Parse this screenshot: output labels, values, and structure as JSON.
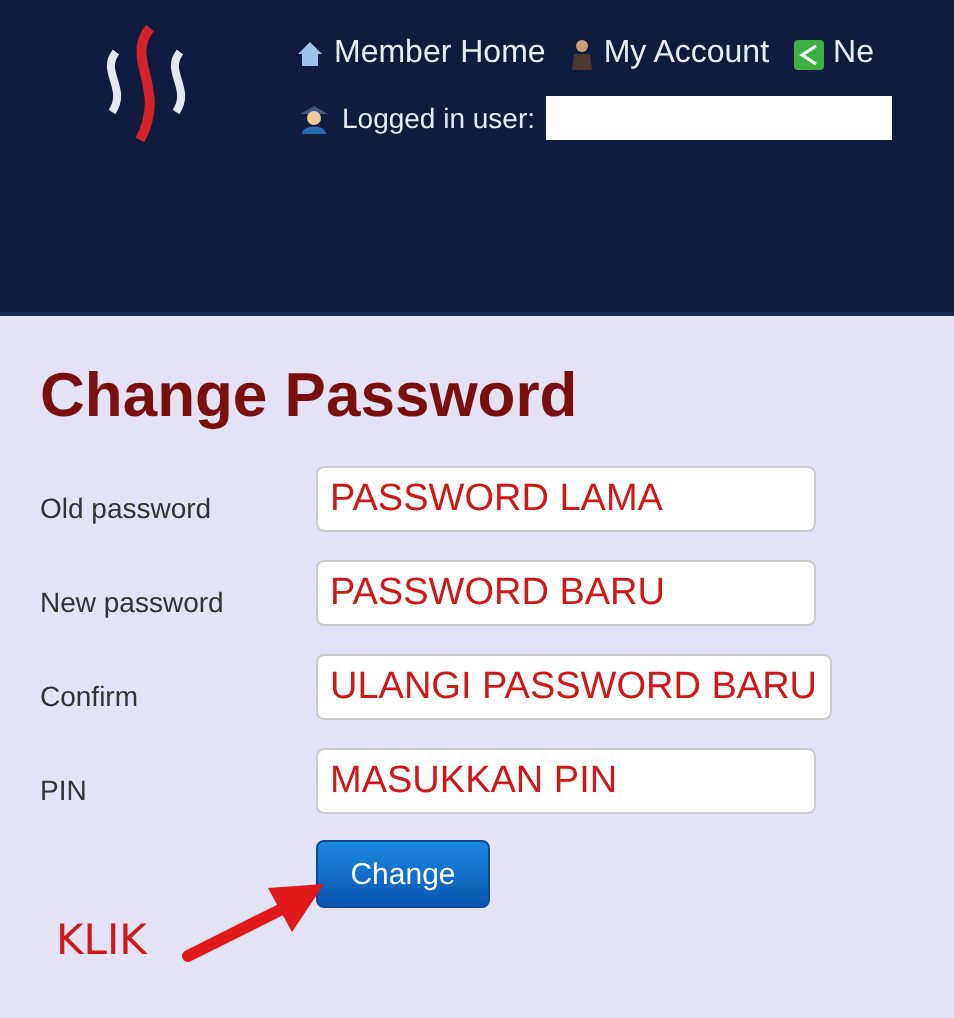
{
  "header": {
    "nav": [
      {
        "kind": "home",
        "label": "Member Home"
      },
      {
        "kind": "account",
        "label": "My Account"
      },
      {
        "kind": "share",
        "label": "Ne"
      }
    ],
    "user_label": "Logged in user:"
  },
  "title": "Change Password",
  "fields": [
    {
      "label": "Old password",
      "annotation": "PASSWORD LAMA"
    },
    {
      "label": "New password",
      "annotation": "PASSWORD BARU"
    },
    {
      "label": "Confirm",
      "annotation": "ULANGI PASSWORD BARU"
    },
    {
      "label": "PIN",
      "annotation": "MASUKKAN PIN"
    }
  ],
  "button": "Change",
  "callout": "KLIK"
}
